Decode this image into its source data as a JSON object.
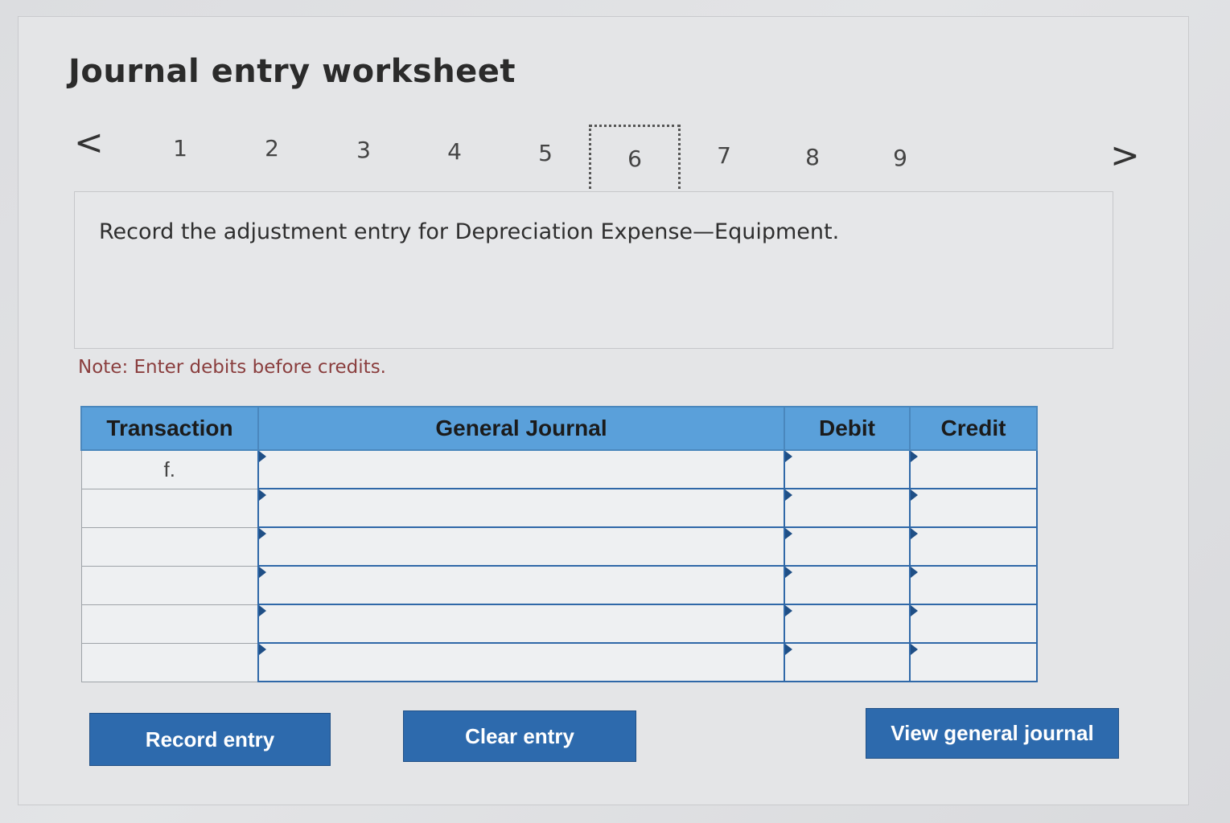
{
  "worksheet": {
    "title": "Journal entry worksheet"
  },
  "navigation": {
    "prev_icon": "chevron-left-icon",
    "next_icon": "chevron-right-icon",
    "prev_glyph": "<",
    "next_glyph": ">",
    "steps": [
      "1",
      "2",
      "3",
      "4",
      "5",
      "6",
      "7",
      "8",
      "9"
    ],
    "active_step": "6"
  },
  "question": {
    "text": "Record the adjustment entry for Depreciation Expense—Equipment."
  },
  "note": {
    "text": "Note: Enter debits before credits."
  },
  "journal_table": {
    "headers": [
      "Transaction",
      "General Journal",
      "Debit",
      "Credit"
    ],
    "rows": [
      {
        "transaction": "f.",
        "account": "",
        "debit": "",
        "credit": ""
      },
      {
        "transaction": "",
        "account": "",
        "debit": "",
        "credit": ""
      },
      {
        "transaction": "",
        "account": "",
        "debit": "",
        "credit": ""
      },
      {
        "transaction": "",
        "account": "",
        "debit": "",
        "credit": ""
      },
      {
        "transaction": "",
        "account": "",
        "debit": "",
        "credit": ""
      },
      {
        "transaction": "",
        "account": "",
        "debit": "",
        "credit": ""
      }
    ]
  },
  "buttons": {
    "record": "Record entry",
    "clear": "Clear entry",
    "view": "View general journal"
  },
  "colors": {
    "header_blue": "#5aa0da",
    "button_blue": "#2d6aad",
    "note_red": "#8a3e3e",
    "cell_border": "#2f68a8"
  }
}
